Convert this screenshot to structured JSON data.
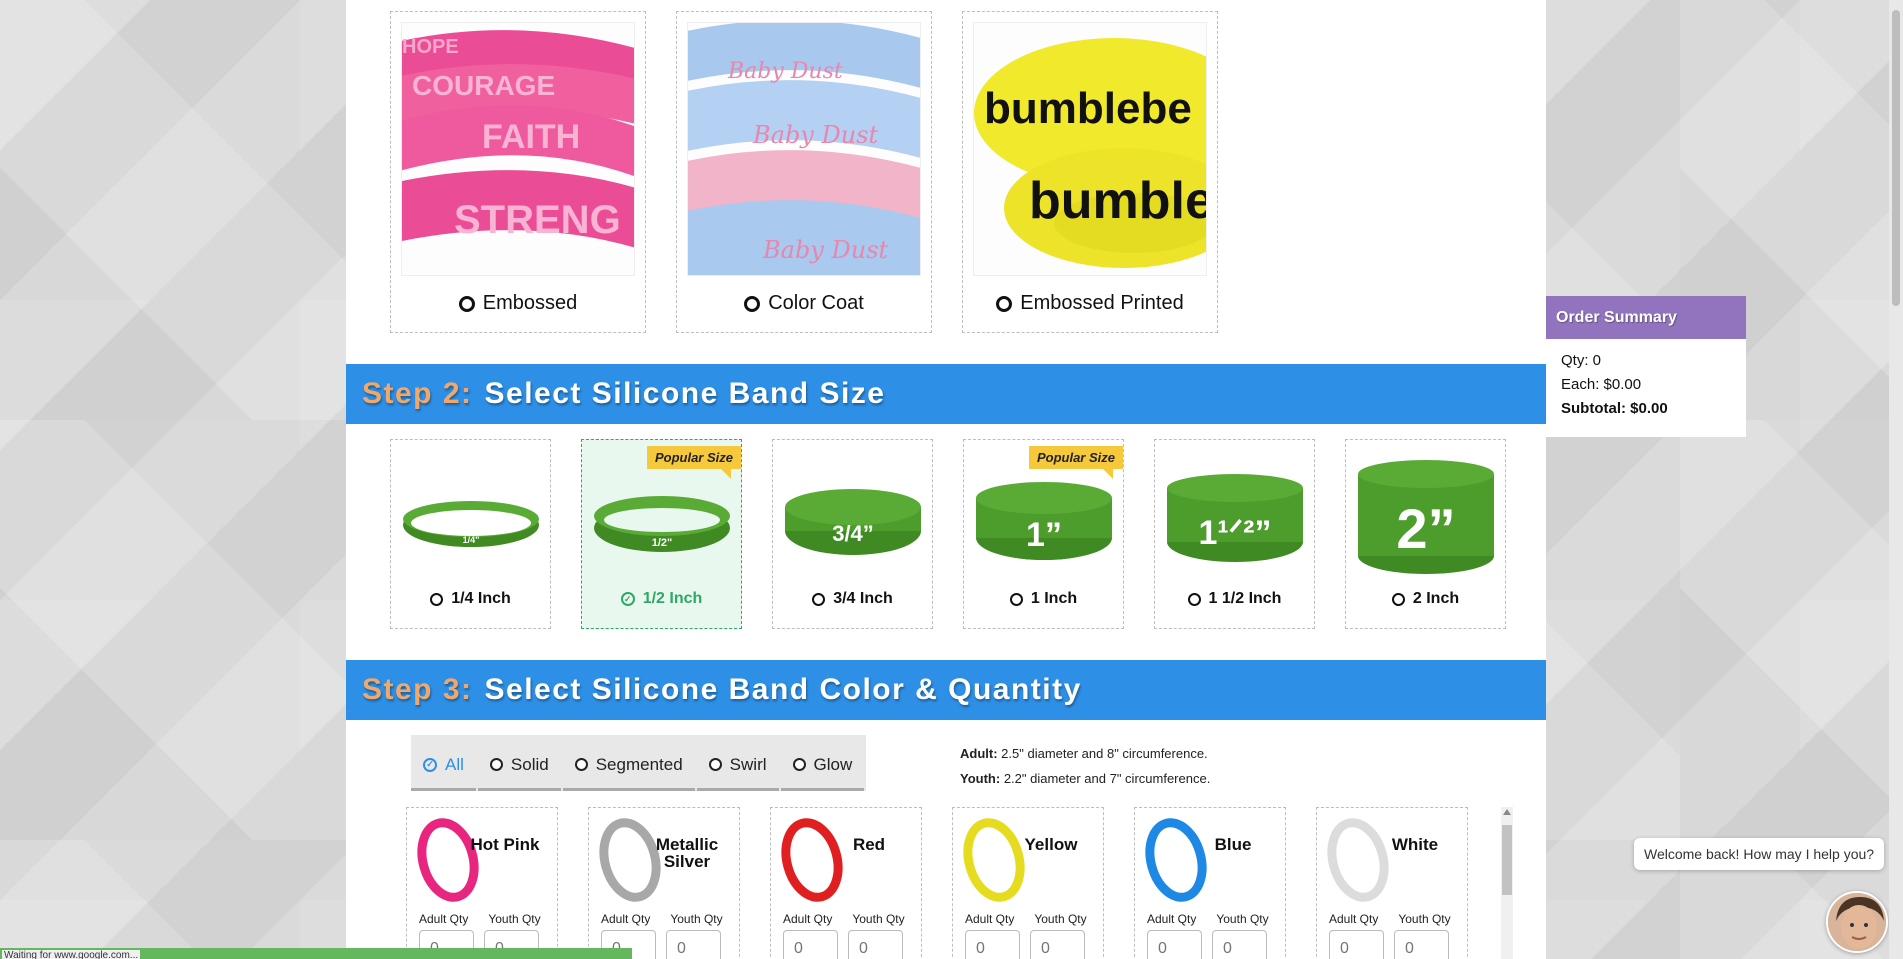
{
  "step1": {
    "types": [
      {
        "label": "Embossed"
      },
      {
        "label": "Color Coat"
      },
      {
        "label": "Embossed Printed"
      }
    ],
    "image_texts": {
      "embossed": [
        "HOPE",
        "COURAGE",
        "FAITH",
        "STRENG"
      ],
      "color_coat": [
        "Baby Dust",
        "Baby Dust",
        "Baby Dust"
      ],
      "embossed_printed": [
        "bumblebe",
        "bumble"
      ]
    }
  },
  "step2": {
    "num": "Step 2:",
    "title": "Select Silicone Band Size",
    "popular_badge": "Popular Size",
    "sizes": [
      {
        "label": "1/4 Inch",
        "band_text": "1/4\""
      },
      {
        "label": "1/2 Inch",
        "band_text": "1/2\""
      },
      {
        "label": "3/4 Inch",
        "band_text": "3/4”"
      },
      {
        "label": "1 Inch",
        "band_text": "1”"
      },
      {
        "label": "1 1/2 Inch",
        "band_text": "1¹ᐟ²”"
      },
      {
        "label": "2 Inch",
        "band_text": "2”"
      }
    ]
  },
  "step3": {
    "num": "Step 3:",
    "title": "Select Silicone Band Color & Quantity",
    "filters": [
      "All",
      "Solid",
      "Segmented",
      "Swirl",
      "Glow"
    ],
    "notes": {
      "adult_label": "Adult:",
      "adult_text": "2.5\" diameter and 8\" circumference.",
      "youth_label": "Youth:",
      "youth_text": "2.2\" diameter and 7\" circumference."
    },
    "qty_labels": {
      "adult": "Adult Qty",
      "youth": "Youth Qty"
    },
    "qty_default": "0",
    "colors": [
      {
        "name": "Hot Pink",
        "hex": "#e8267f"
      },
      {
        "name": "Metallic Silver",
        "hex": "#a8a8a8"
      },
      {
        "name": "Red",
        "hex": "#e02020"
      },
      {
        "name": "Yellow",
        "hex": "#e6dc1f"
      },
      {
        "name": "Blue",
        "hex": "#1e88e5"
      },
      {
        "name": "White",
        "hex": "#e8e8e8"
      }
    ]
  },
  "summary": {
    "title": "Order Summary",
    "qty": "Qty: 0",
    "each": "Each: $0.00",
    "subtotal": "Subtotal: $0.00"
  },
  "chat": {
    "message": "Welcome back! How may I help you?"
  },
  "status": {
    "text": "Waiting for www.google.com..."
  },
  "colors": {
    "step_bar": "#2d8fe5",
    "step_num": "#f0a86a",
    "band_green": "#4a9a2a",
    "selected_green": "#2fa866",
    "badge_yellow": "#f6c83c",
    "summary_purple": "#9174bd"
  }
}
